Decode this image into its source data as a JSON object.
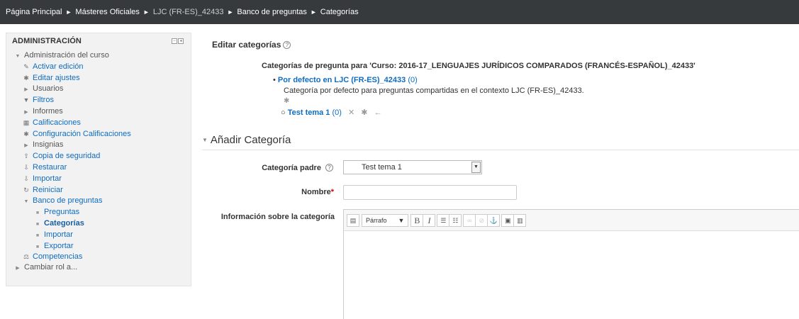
{
  "breadcrumb": {
    "items": [
      "Página Principal",
      "Másteres Oficiales",
      "LJC (FR-ES)_42433",
      "Banco de preguntas",
      "Categorías"
    ],
    "separator": "►"
  },
  "admin_block": {
    "title": "ADMINISTRACIÓN",
    "root": "Administración del curso",
    "items": [
      {
        "label": "Activar edición",
        "icon": "pencil-icon"
      },
      {
        "label": "Editar ajustes",
        "icon": "gear-icon"
      },
      {
        "label": "Usuarios",
        "icon": "caret-right-icon"
      },
      {
        "label": "Filtros",
        "icon": "filter-icon"
      },
      {
        "label": "Informes",
        "icon": "caret-right-icon"
      },
      {
        "label": "Calificaciones",
        "icon": "table-icon"
      },
      {
        "label": "Configuración Calificaciones",
        "icon": "gear-icon"
      },
      {
        "label": "Insignias",
        "icon": "caret-right-icon"
      },
      {
        "label": "Copia de seguridad",
        "icon": "upload-icon"
      },
      {
        "label": "Restaurar",
        "icon": "download-icon"
      },
      {
        "label": "Importar",
        "icon": "download-icon"
      },
      {
        "label": "Reiniciar",
        "icon": "reset-icon"
      },
      {
        "label": "Banco de preguntas",
        "icon": "caret-down-icon"
      }
    ],
    "bank_items": [
      "Preguntas",
      "Categorías",
      "Importar",
      "Exportar"
    ],
    "competencias": "Competencias",
    "cambiar_rol": "Cambiar rol a..."
  },
  "main": {
    "title": "Editar categorías",
    "category_heading": "Categorías de pregunta para 'Curso: 2016-17_LENGUAJES JURÍDICOS COMPARADOS (FRANCÉS-ESPAÑOL)_42433'",
    "default_category": {
      "name": "Por defecto en LJC (FR-ES)_42433",
      "count": "(0)"
    },
    "default_description": "Categoría por defecto para preguntas compartidas en el contexto LJC (FR-ES)_42433.",
    "sub_category": {
      "name": "Test tema 1",
      "count": "(0)"
    }
  },
  "form": {
    "section_title": "Añadir Categoría",
    "parent_label": "Categoría padre",
    "parent_value": "Test tema 1",
    "name_label": "Nombre",
    "required_mark": "*",
    "info_label": "Información sobre la categoría",
    "editor": {
      "format_select": "Párrafo"
    }
  },
  "colors": {
    "navbar": "#373a3c",
    "link": "#0f6cbf",
    "block_bg": "#f2f2f2",
    "required": "#cc0000"
  }
}
